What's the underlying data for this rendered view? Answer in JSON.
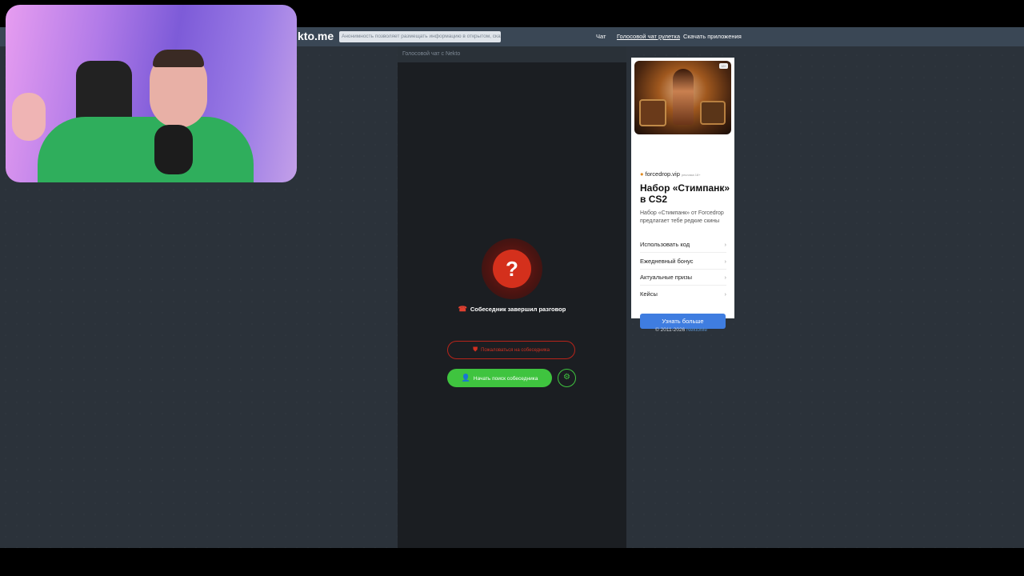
{
  "site": {
    "logo": "kto.me",
    "notice": "Анонимность позволяет размещать информацию в открытом, сказать видел"
  },
  "nav": {
    "items": [
      {
        "label": "Чат"
      },
      {
        "label": "Голосовой чат рулетка"
      },
      {
        "label": "Скачать приложения"
      }
    ]
  },
  "chat": {
    "header": "Голосовой чат с Nekto",
    "question_mark": "?",
    "status_text": "Собеседник завершил разговор",
    "report_button": "Пожаловаться на собеседника",
    "search_button": "Начать поиск собеседника"
  },
  "ad": {
    "badge": "18+",
    "domain": "forcedrop.vip",
    "domain_sub": "реклама 18+",
    "title": "Набор «Стимпанк» в CS2",
    "description": "Набор «Стимпанк» от Forcedrop предлагает тебе редкие скины",
    "links": [
      {
        "label": "Использовать код"
      },
      {
        "label": "Ежедневный бонус"
      },
      {
        "label": "Актуальные призы"
      },
      {
        "label": "Кейсы"
      }
    ],
    "cta": "Узнать больше"
  },
  "footer": {
    "copyright": "© 2011-2026",
    "link": "NektoMe"
  },
  "colors": {
    "page_bg": "#2b323a",
    "topbar_bg": "#3a4755",
    "chat_bg": "#1b1e22",
    "accent_red": "#d4301c",
    "accent_green": "#3fc43f",
    "ad_cta_blue": "#3f7de0"
  },
  "icons": {
    "end_call": "phone-hangup-icon",
    "report": "shield-icon",
    "search": "person-search-icon",
    "filter": "sliders-icon",
    "chevron": "chevron-right-icon"
  }
}
